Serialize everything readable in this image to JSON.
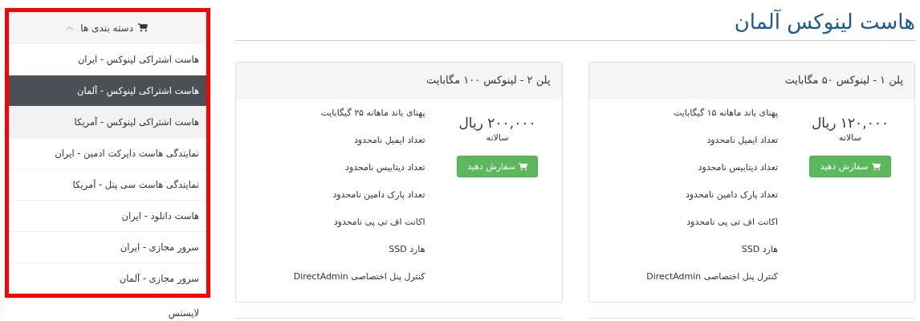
{
  "page": {
    "title": "هاست لینوکس آلمان",
    "plans": [
      {
        "name": "پلن ۱ - لینوکس ۵۰ مگابایت",
        "price": "۱۲۰,۰۰۰ ریال",
        "period": "سالانه",
        "order_button": "سفارش دهید",
        "features": [
          "پهنای باند ماهانه ۱۵ گیگابایت",
          "تعداد ایمیل نامحدود",
          "تعداد دیتابیس نامحدود",
          "تعداد پارک دامین نامحدود",
          "اکانت اف تی پی نامحدود",
          "هارد SSD",
          "کنترل پنل اختصاصی DirectAdmin"
        ]
      },
      {
        "name": "پلن ۲ - لینوکس ۱۰۰ مگابایت",
        "price": "۲۰۰,۰۰۰ ریال",
        "period": "سالانه",
        "order_button": "سفارش دهید",
        "features": [
          "پهنای باند ماهانه ۲۵ گیگابایت",
          "تعداد ایمیل نامحدود",
          "تعداد دیتابیس نامحدود",
          "تعداد پارک دامین نامحدود",
          "اکانت اف تی پی نامحدود",
          "هارد SSD",
          "کنترل پنل اختصاصی DirectAdmin"
        ]
      }
    ]
  },
  "sidebar": {
    "categories": {
      "title": "دسته بندی ها",
      "expanded": true,
      "highlighted": true,
      "items": [
        {
          "label": "هاست اشتراکی لینوکس - ایران",
          "selected": false,
          "hover": false
        },
        {
          "label": "هاست اشتراکی لینوکس - آلمان",
          "selected": true,
          "hover": false
        },
        {
          "label": "هاست اشتراکی لینوکس - آمریکا",
          "selected": false,
          "hover": true
        },
        {
          "label": "نمایندگی هاست دایرکت ادمین - ایران",
          "selected": false,
          "hover": false
        },
        {
          "label": "نمایندگی هاست سی پنل - آمریکا",
          "selected": false,
          "hover": false
        },
        {
          "label": "هاست دانلود - ایران",
          "selected": false,
          "hover": false
        },
        {
          "label": "سرور مجازی - ایران",
          "selected": false,
          "hover": false
        },
        {
          "label": "سرور مجازی - آلمان",
          "selected": false,
          "hover": false
        }
      ]
    },
    "more_items": [
      {
        "label": "لایسنس",
        "selected": false
      }
    ]
  }
}
